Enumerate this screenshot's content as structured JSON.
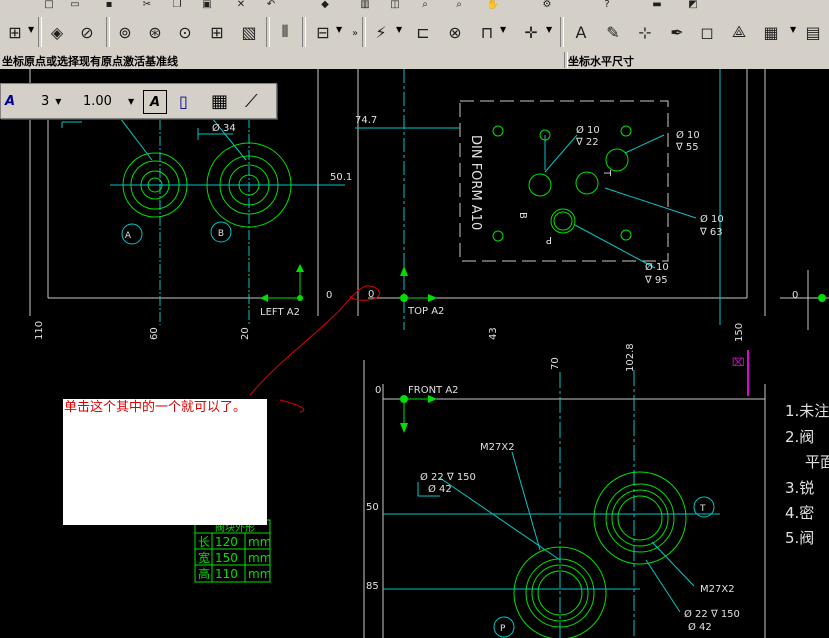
{
  "statusbar": {
    "left_text": "坐标原点或选择现有原点激活基准线",
    "right_text": "坐标水平尺寸"
  },
  "dim_toolbar": {
    "precision_value": "3",
    "scale_value": "1.00"
  },
  "annotation": {
    "text": "单击这个其中的一个就可以了。"
  },
  "drawing": {
    "views": {
      "left": "LEFT A2",
      "top": "TOP A2",
      "front": "FRONT A2"
    },
    "coords_left": {
      "a": "110",
      "b": "60",
      "c": "20",
      "d": "0",
      "y": "50.1"
    },
    "coords_top": {
      "a": "74.7",
      "b": "0",
      "c": "43",
      "d": "150",
      "e": "0",
      "f": "0"
    },
    "coords_front": {
      "a": "0",
      "b": "70",
      "c": "102.8",
      "d": "50",
      "e": "85",
      "f": "0"
    },
    "hole_labels": {
      "A": "A",
      "B": "B",
      "T": "T",
      "P": "P",
      "b_side": "B",
      "p_side": "P",
      "t_side": "T"
    },
    "din_label": "DIN FORM A10",
    "callouts": {
      "d34": "Ø 34",
      "d10a": "Ø 10",
      "d22a": "∇ 22",
      "d10b": "Ø 10",
      "d55": "∇ 55",
      "d10c": "Ø 10",
      "d63": "∇ 63",
      "d10d": "Ø 10",
      "d95": "∇ 95",
      "m27a": "M27X2",
      "d22b": "Ø 22 ∇ 150",
      "d42a": "Ø 42",
      "m27b": "M27X2",
      "d22c": "Ø 22 ∇ 150",
      "d42b": "Ø 42"
    },
    "notes": [
      "1.未注",
      "2.阀",
      "平面",
      "3.锐",
      "4.密",
      "5.阀"
    ],
    "size_table": {
      "title": "阀块外形",
      "rows": [
        [
          "长",
          "120",
          "mm"
        ],
        [
          "宽",
          "150",
          "mm"
        ],
        [
          "高",
          "110",
          "mm"
        ]
      ]
    }
  }
}
